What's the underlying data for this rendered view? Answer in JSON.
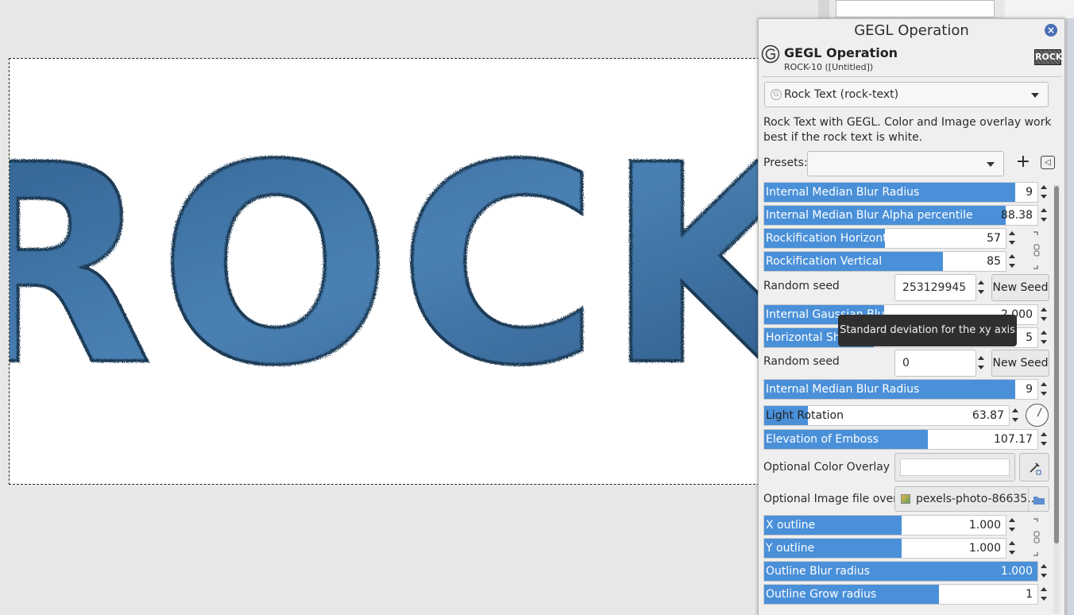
{
  "canvas": {
    "rock_text": "ROCK"
  },
  "dialog": {
    "window_title": "GEGL Operation",
    "header_title": "GEGL Operation",
    "header_subtitle": "ROCK-10 ([Untitled])",
    "thumbnail_text": "ROCK",
    "operation": "Rock Text (rock-text)",
    "description": "Rock Text with GEGL. Color and Image overlay work best if the rock text is white.",
    "presets_label": "Presets:",
    "presets_value": ""
  },
  "params": {
    "median_blur_radius_1": {
      "label": "Internal Median Blur Radius",
      "value": "9",
      "fraction": 0.92
    },
    "median_alpha_pct": {
      "label": "Internal Median Blur Alpha percentile",
      "value": "88.38",
      "fraction": 0.8838
    },
    "rock_horizontal": {
      "label": "Rockification Horizontal",
      "value": "57",
      "fraction": 0.5
    },
    "rock_vertical": {
      "label": "Rockification Vertical",
      "value": "85",
      "fraction": 0.74
    },
    "random_seed_1": {
      "label": "Random seed",
      "value": "253129945",
      "button": "New Seed"
    },
    "gaussian_blur": {
      "label": "Internal Gaussian Blur",
      "value": "2.000",
      "fraction": 0.44
    },
    "horizontal_shift": {
      "label": "Horizontal Shift",
      "value": "5",
      "fraction": 0.4
    },
    "random_seed_2": {
      "label": "Random seed",
      "value": "0",
      "button": "New Seed"
    },
    "median_blur_radius_2": {
      "label": "Internal Median Blur Radius",
      "value": "9",
      "fraction": 0.92
    },
    "light_rotation": {
      "label": "Light Rotation",
      "value": "63.87",
      "fraction": 0.177
    },
    "emboss_elevation": {
      "label": "Elevation of Emboss",
      "value": "107.17",
      "fraction": 0.6
    },
    "color_overlay": {
      "label": "Optional Color Overlay",
      "color": "#ffffff"
    },
    "image_overlay": {
      "label": "Optional Image file overlay",
      "file": "pexels-photo-86635..."
    },
    "x_outline": {
      "label": "X outline",
      "value": "1.000",
      "fraction": 0.57
    },
    "y_outline": {
      "label": "Y outline",
      "value": "1.000",
      "fraction": 0.57
    },
    "outline_blur": {
      "label": "Outline Blur radius",
      "value": "1.000",
      "fraction": 1.0
    },
    "outline_grow": {
      "label": "Outline Grow radius",
      "value": "1",
      "fraction": 0.64
    }
  },
  "tooltip": "Standard deviation for the xy axis",
  "colors": {
    "accent": "#4a90d9",
    "rock": "#3a6a98"
  }
}
